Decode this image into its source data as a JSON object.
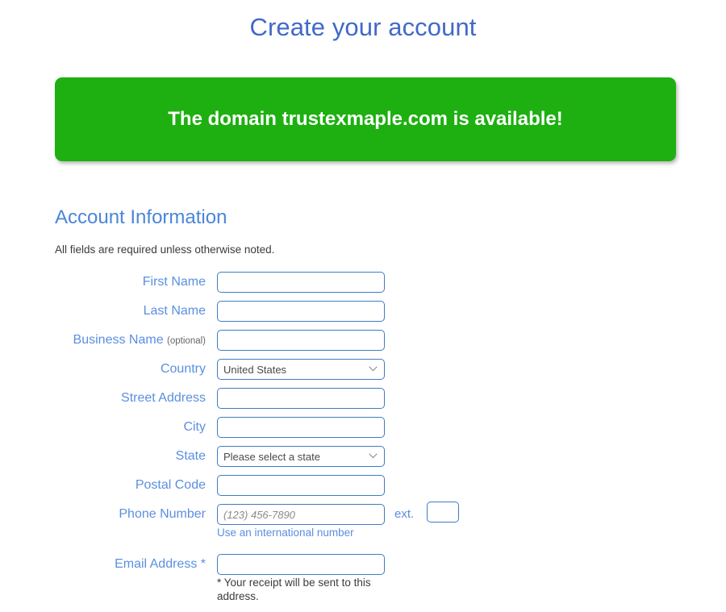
{
  "page": {
    "title": "Create your account"
  },
  "banner": {
    "message": "The domain trustexmaple.com is available!",
    "background_color": "#1db010",
    "text_color": "#ffffff"
  },
  "section": {
    "heading": "Account Information",
    "note": "All fields are required unless otherwise noted."
  },
  "form": {
    "first_name": {
      "label": "First Name",
      "value": "",
      "placeholder": ""
    },
    "last_name": {
      "label": "Last Name",
      "value": "",
      "placeholder": ""
    },
    "business_name": {
      "label": "Business Name",
      "optional_suffix": "(optional)",
      "value": "",
      "placeholder": ""
    },
    "country": {
      "label": "Country",
      "selected": "United States"
    },
    "street_address": {
      "label": "Street Address",
      "value": "",
      "placeholder": ""
    },
    "city": {
      "label": "City",
      "value": "",
      "placeholder": ""
    },
    "state": {
      "label": "State",
      "selected": "Please select a state"
    },
    "postal_code": {
      "label": "Postal Code",
      "value": "",
      "placeholder": ""
    },
    "phone_number": {
      "label": "Phone Number",
      "value": "",
      "placeholder": "(123) 456-7890",
      "ext_label": "ext.",
      "ext_value": "",
      "international_link": "Use an international number"
    },
    "email_address": {
      "label": "Email Address *",
      "value": "",
      "placeholder": "",
      "note": "* Your receipt will be sent to this address."
    }
  },
  "colors": {
    "title_blue": "#4169c8",
    "label_blue": "#5b8fe0",
    "heading_blue": "#4a86d8",
    "input_border": "#3f7bc4",
    "success_green": "#1db010"
  }
}
